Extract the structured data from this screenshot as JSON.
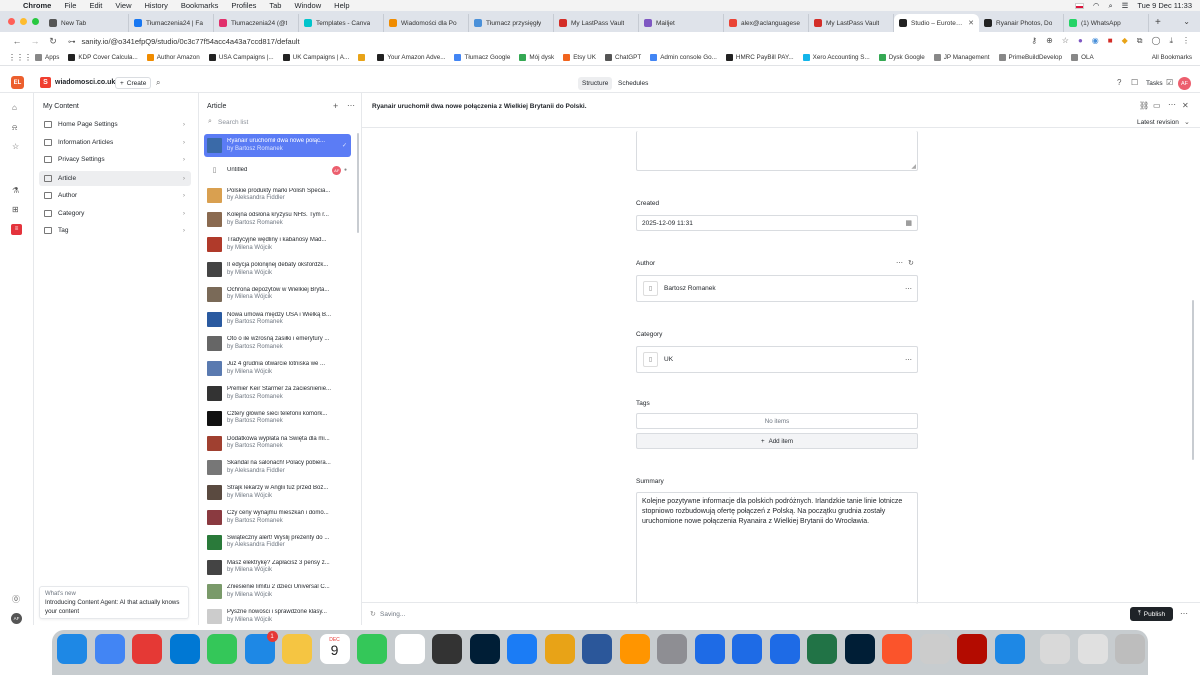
{
  "menubar": {
    "apple": "",
    "items": [
      "Chrome",
      "File",
      "Edit",
      "View",
      "History",
      "Bookmarks",
      "Profiles",
      "Tab",
      "Window",
      "Help"
    ],
    "datetime": "Tue 9 Dec  11:33"
  },
  "tabs": [
    {
      "label": "New Tab",
      "color": "#555"
    },
    {
      "label": "Tłumaczenia24 | Fa",
      "color": "#1877f2"
    },
    {
      "label": "Tłumaczenia24 (@t",
      "color": "#e1306c"
    },
    {
      "label": "Templates - Canva",
      "color": "#00c4cc"
    },
    {
      "label": "Wiadomości dla Po",
      "color": "#f08c00"
    },
    {
      "label": "Tłumacz przysięgły",
      "color": "#4a90d9"
    },
    {
      "label": "My LastPass Vault",
      "color": "#d32d27"
    },
    {
      "label": "Mailjet",
      "color": "#7e57c2"
    },
    {
      "label": "alex@aclanguagese",
      "color": "#ea4335"
    },
    {
      "label": "My LastPass Vault",
      "color": "#d32d27"
    },
    {
      "label": "Studio – Eurotext L",
      "color": "#222"
    },
    {
      "label": "Ryanair Photos, Do",
      "color": "#222"
    },
    {
      "label": "(1) WhatsApp",
      "color": "#25d366"
    }
  ],
  "address": {
    "url": "sanity.io/@o341efpQ9/studio/0c3c77f54acc4a43a7ccd817/default"
  },
  "bookmarks": [
    {
      "label": "Apps",
      "color": "#888"
    },
    {
      "label": "KDP Cover Calcula...",
      "color": "#222"
    },
    {
      "label": "Author Amazon",
      "color": "#f08c00"
    },
    {
      "label": "USA Campaigns |...",
      "color": "#222"
    },
    {
      "label": "UK Campaigns | A...",
      "color": "#222"
    },
    {
      "label": "",
      "color": "#e8a317"
    },
    {
      "label": "Your Amazon Adve...",
      "color": "#222"
    },
    {
      "label": "Tłumacz Google",
      "color": "#4285f4"
    },
    {
      "label": "Mój dysk",
      "color": "#34a853"
    },
    {
      "label": "Etsy UK",
      "color": "#f1641e"
    },
    {
      "label": "ChatGPT",
      "color": "#555"
    },
    {
      "label": "Admin console Go...",
      "color": "#4285f4"
    },
    {
      "label": "HMRC PayBill PAY...",
      "color": "#222"
    },
    {
      "label": "Xero Accounting S...",
      "color": "#13b5ea"
    },
    {
      "label": "Dysk Google",
      "color": "#34a853"
    },
    {
      "label": "JP Management",
      "color": "#888"
    },
    {
      "label": "PrimeBuildDevelop",
      "color": "#888"
    },
    {
      "label": "OLA",
      "color": "#888"
    }
  ],
  "all_bookmarks": "All Bookmarks",
  "header": {
    "workspace_badge": "EL",
    "site": "wiadomosci.co.uk",
    "create": "Create",
    "structure": "Structure",
    "schedules": "Schedules",
    "tasks": "Tasks",
    "avatar": "AF"
  },
  "pane1": {
    "title": "My Content",
    "items": [
      "Home Page Settings",
      "Information Articles",
      "Privacy Settings",
      "Article",
      "Author",
      "Category",
      "Tag"
    ],
    "selected": 3
  },
  "whatsnew": {
    "label": "What's new",
    "text": "Introducing Content Agent: AI that actually knows your content"
  },
  "pane2": {
    "title": "Article",
    "search_placeholder": "Search list",
    "docs": [
      {
        "title": "Ryanair uruchomił dwa nowe połąc...",
        "author": "by Bartosz Romanek",
        "selected": true,
        "thumb": "#3a6aa8"
      },
      {
        "title": "Untitled",
        "author": "",
        "untitled": true,
        "thumb": "#fff"
      },
      {
        "title": "Polskie produkty marki Polish Specia...",
        "author": "by Aleksandra Fiddler",
        "thumb": "#d9a050"
      },
      {
        "title": "Kolejna odsłona kryzysu NHS. Tym r...",
        "author": "by Bartosz Romanek",
        "thumb": "#8a6a50"
      },
      {
        "title": "Tradycyjne wędliny i kabanosy Mad...",
        "author": "by Milena Wójcik",
        "thumb": "#b03a2a"
      },
      {
        "title": "II edycja polonijnej debaty oksfordzk...",
        "author": "by Milena Wójcik",
        "thumb": "#444"
      },
      {
        "title": "Ochrona depozytów w Wielkiej Bryta...",
        "author": "by Milena Wójcik",
        "thumb": "#7a6a58"
      },
      {
        "title": "Nowa umowa między USA i Wielką B...",
        "author": "by Bartosz Romanek",
        "thumb": "#2a5aa0"
      },
      {
        "title": "Oto o ile wzrosną zasiłki i emerytury ...",
        "author": "by Bartosz Romanek",
        "thumb": "#666"
      },
      {
        "title": "Już 4 grudnia otwarcie lotniska we ...",
        "author": "by Milena Wójcik",
        "thumb": "#5a7ab0"
      },
      {
        "title": "Premier Keir Starmer za zacieśnienie...",
        "author": "by Bartosz Romanek",
        "thumb": "#333"
      },
      {
        "title": "Cztery główne sieci telefonii komórk...",
        "author": "by Bartosz Romanek",
        "thumb": "#111"
      },
      {
        "title": "Dodatkowa wypłata na Święta dla mi...",
        "author": "by Bartosz Romanek",
        "thumb": "#a04030"
      },
      {
        "title": "Skandal na salonach! Polacy pobiera...",
        "author": "by Aleksandra Fiddler",
        "thumb": "#777"
      },
      {
        "title": "Strajk lekarzy w Anglii tuż przed Boż...",
        "author": "by Milena Wójcik",
        "thumb": "#5a4a40"
      },
      {
        "title": "Czy ceny wynajmu mieszkań i domó...",
        "author": "by Bartosz Romanek",
        "thumb": "#8a3a40"
      },
      {
        "title": "Świąteczny alert! Wyślij prezenty do ...",
        "author": "by Aleksandra Fiddler",
        "thumb": "#2a7a3a"
      },
      {
        "title": "Masz elektrykę? Zapłacisz 3 pensy z...",
        "author": "by Milena Wójcik",
        "thumb": "#444"
      },
      {
        "title": "Zniesienie limitu 2 dzieci Universal C...",
        "author": "by Milena Wójcik",
        "thumb": "#7a9a6a"
      },
      {
        "title": "Pyszne nowości i sprawdzone klasy...",
        "author": "by Milena Wójcik",
        "thumb": "#ccc"
      }
    ]
  },
  "editor": {
    "title": "Ryanair uruchomił dwa nowe połączenia z Wielkiej Brytanii do Polski.",
    "revision": "Latest revision",
    "created_label": "Created",
    "created_value": "2025-12-09 11:31",
    "author_label": "Author",
    "author_value": "Bartosz Romanek",
    "category_label": "Category",
    "category_value": "UK",
    "tags_label": "Tags",
    "tags_empty": "No items",
    "add_item": "Add item",
    "summary_label": "Summary",
    "summary_value": "Kolejne pozytywne informacje dla polskich podróżnych. Irlandzkie tanie linie lotnicze stopniowo rozbudowują ofertę połączeń z Polską. Na początku grudnia zostały uruchomione nowe połączenia Ryanaira z Wielkiej Brytanii do Wrocławia.",
    "status": "Saving...",
    "publish": "Publish",
    "untitled_avatar": "AF"
  },
  "dock": {
    "calendar_month": "DEC",
    "calendar_day": "9",
    "mail_badge": "1"
  }
}
